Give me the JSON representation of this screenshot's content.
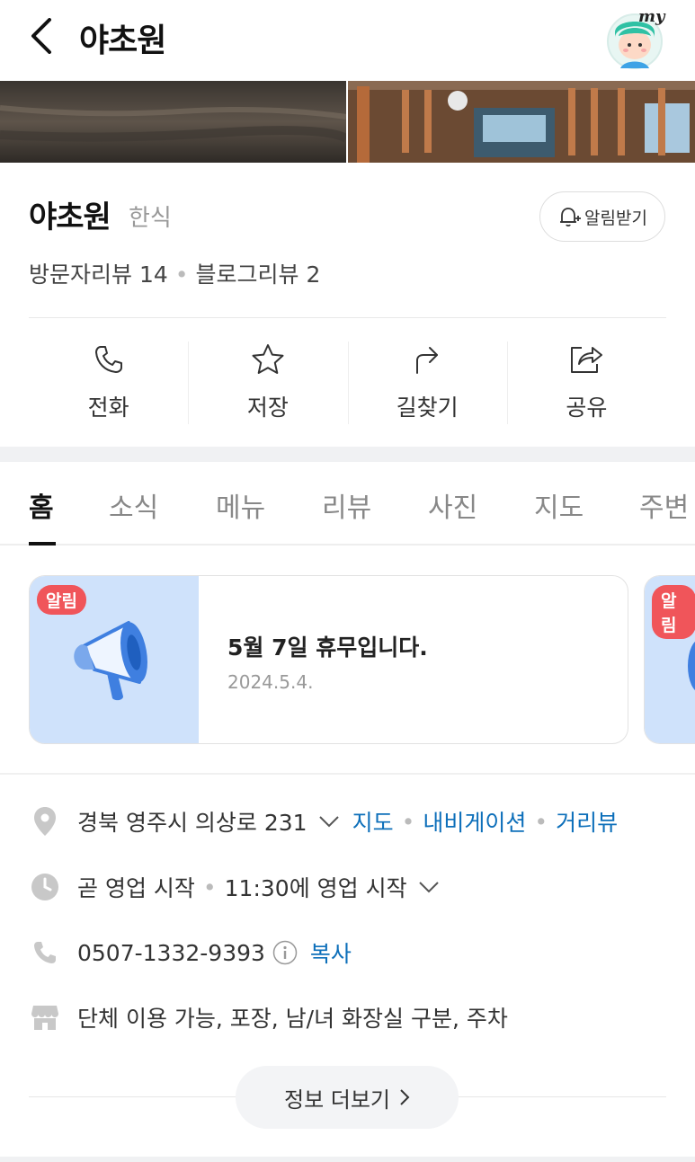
{
  "header": {
    "title": "야초원",
    "avatar_text": "my"
  },
  "place": {
    "name": "야초원",
    "category": "한식",
    "alarm_label": "알림받기",
    "visitor_reviews": "방문자리뷰 14",
    "blog_reviews": "블로그리뷰 2"
  },
  "actions": [
    {
      "label": "전화",
      "icon": "phone-icon"
    },
    {
      "label": "저장",
      "icon": "star-icon"
    },
    {
      "label": "길찾기",
      "icon": "directions-icon"
    },
    {
      "label": "공유",
      "icon": "share-icon"
    }
  ],
  "tabs": [
    "홈",
    "소식",
    "메뉴",
    "리뷰",
    "사진",
    "지도",
    "주변"
  ],
  "active_tab": "홈",
  "notices": [
    {
      "badge": "알림",
      "title": "5월 7일 휴무입니다.",
      "date": "2024.5.4."
    },
    {
      "badge": "알림"
    }
  ],
  "info": {
    "address": "경북 영주시 의상로 231",
    "address_links": [
      "지도",
      "내비게이션",
      "거리뷰"
    ],
    "status": "곧 영업 시작",
    "hours": "11:30에 영업 시작",
    "phone": "0507-1332-9393",
    "copy_label": "복사",
    "amenities": "단체 이용 가능, 포장, 남/녀 화장실 구분, 주차",
    "more_label": "정보 더보기"
  },
  "colors": {
    "link": "#0d6fba",
    "badge": "#f0555a",
    "notice_bg": "#cfe2fb",
    "megaphone": "#3f7fe0"
  }
}
